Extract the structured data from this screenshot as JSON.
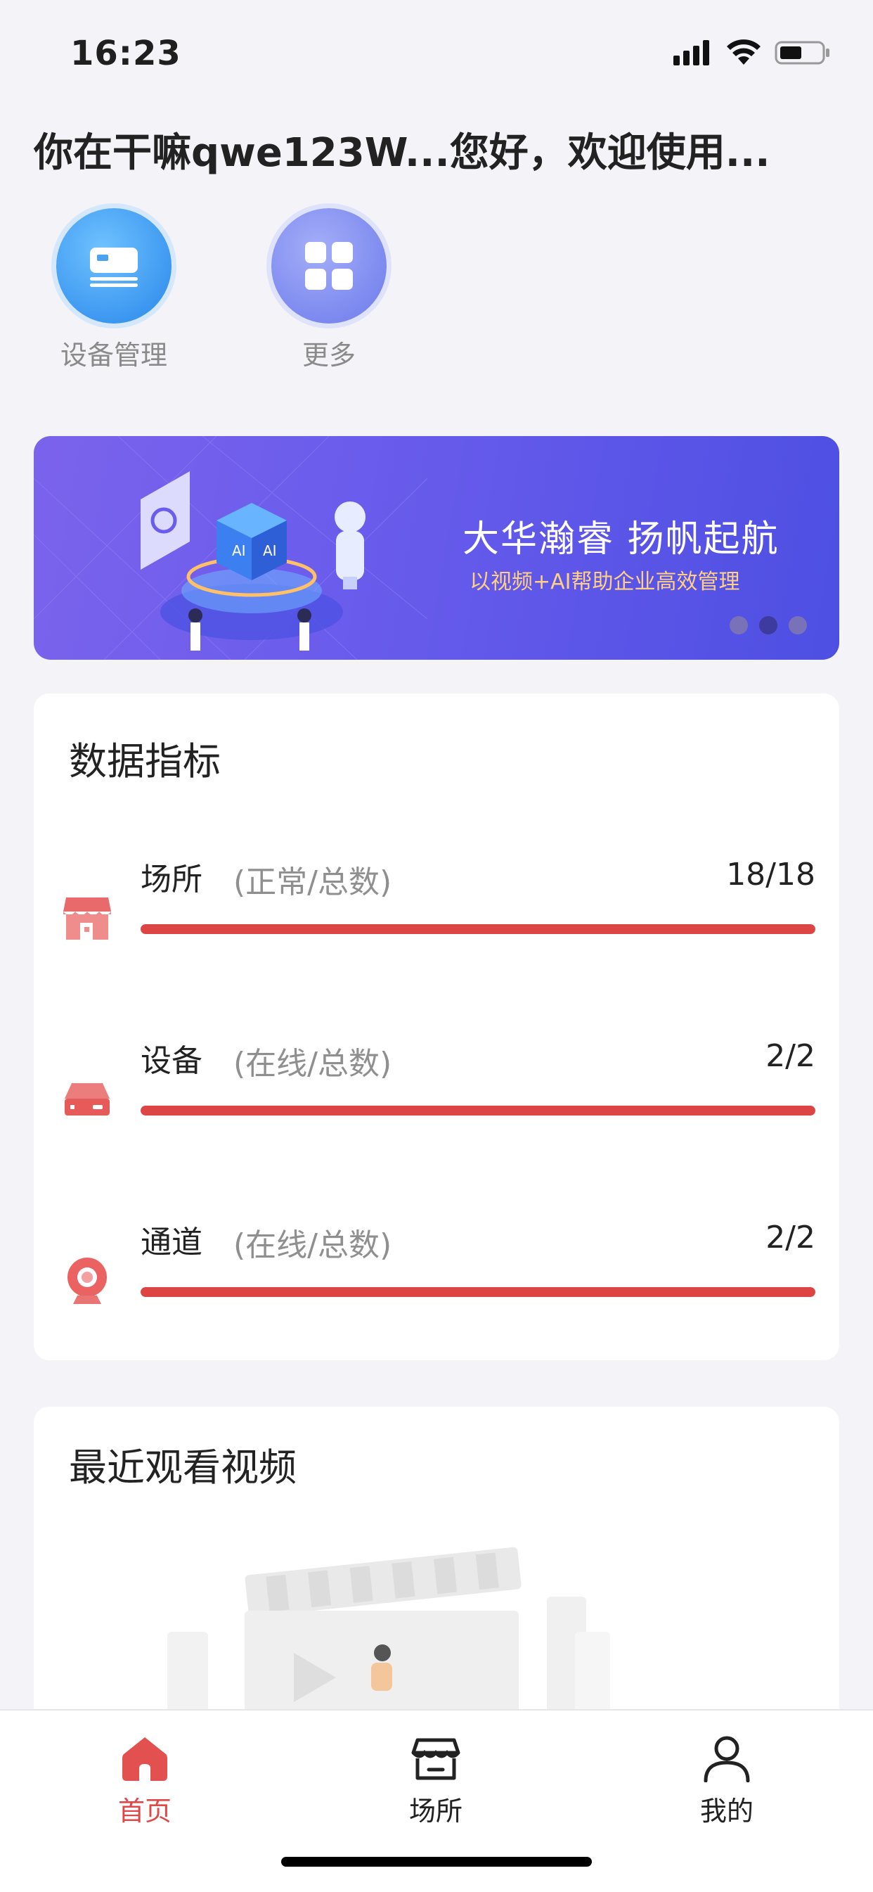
{
  "status_bar": {
    "time": "16:23"
  },
  "greeting": "你在干嘛qwe123W...您好，欢迎使用...",
  "quick_actions": [
    {
      "label": "设备管理",
      "icon": "device-card-icon"
    },
    {
      "label": "更多",
      "icon": "grid-icon"
    }
  ],
  "banner": {
    "title": "大华瀚睿 扬帆起航",
    "subtitle": "以视频+AI帮助企业高效管理",
    "active_dot": 2,
    "dot_count": 3
  },
  "metrics_card": {
    "title": "数据指标",
    "items": [
      {
        "name": "场所",
        "hint": "(正常/总数)",
        "value": "18/18",
        "ratio": 1.0,
        "icon": "store-icon"
      },
      {
        "name": "设备",
        "hint": "(在线/总数)",
        "value": "2/2",
        "ratio": 1.0,
        "icon": "server-icon"
      },
      {
        "name": "通道",
        "hint": "(在线/总数)",
        "value": "2/2",
        "ratio": 1.0,
        "icon": "camera-icon"
      }
    ]
  },
  "recent_card": {
    "title": "最近观看视频"
  },
  "tabbar": [
    {
      "label": "首页",
      "icon": "home-icon",
      "active": true
    },
    {
      "label": "场所",
      "icon": "shop-icon",
      "active": false
    },
    {
      "label": "我的",
      "icon": "user-icon",
      "active": false
    }
  ],
  "colors": {
    "accent": "#dd4545",
    "background": "#f4f4f8",
    "banner": "#6a5cec"
  }
}
